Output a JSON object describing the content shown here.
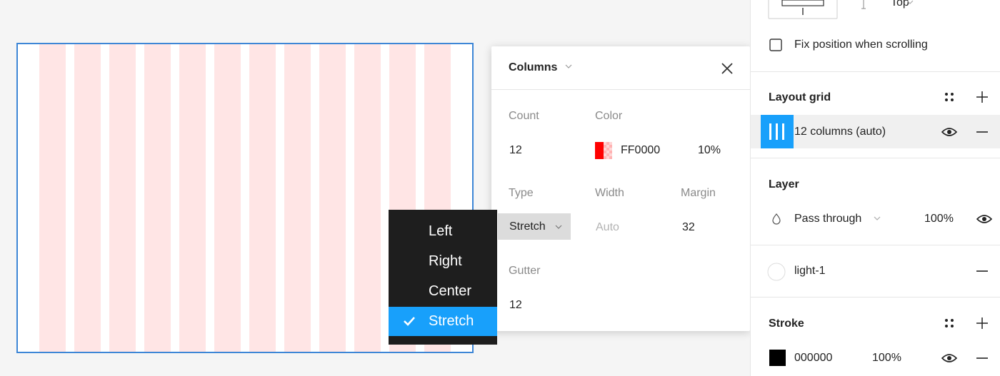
{
  "canvas": {
    "column_count": 12,
    "column_color": "#ffe5e5",
    "frame_border_color": "#3d86d6"
  },
  "popover": {
    "title": "Columns",
    "count_label": "Count",
    "count_value": "12",
    "color_label": "Color",
    "color_hex": "FF0000",
    "color_opacity": "10%",
    "type_label": "Type",
    "type_value": "Stretch",
    "width_label": "Width",
    "width_value": "Auto",
    "margin_label": "Margin",
    "margin_value": "32",
    "gutter_label": "Gutter",
    "gutter_value": "12"
  },
  "type_menu": {
    "items": [
      {
        "label": "Left",
        "selected": false
      },
      {
        "label": "Right",
        "selected": false
      },
      {
        "label": "Center",
        "selected": false
      },
      {
        "label": "Stretch",
        "selected": true
      }
    ],
    "accent": "#18a0fb"
  },
  "right_panel": {
    "constraint_vertical": "Top",
    "fix_position_label": "Fix position when scrolling",
    "fix_position_checked": false,
    "layout_grid": {
      "title": "Layout grid",
      "item_label": "12 columns (auto)",
      "icon_color": "#18a0fb"
    },
    "layer": {
      "title": "Layer",
      "blend_mode": "Pass through",
      "opacity": "100%"
    },
    "fill": {
      "style_name": "light-1"
    },
    "stroke": {
      "title": "Stroke",
      "color_hex": "000000",
      "opacity": "100%"
    }
  }
}
